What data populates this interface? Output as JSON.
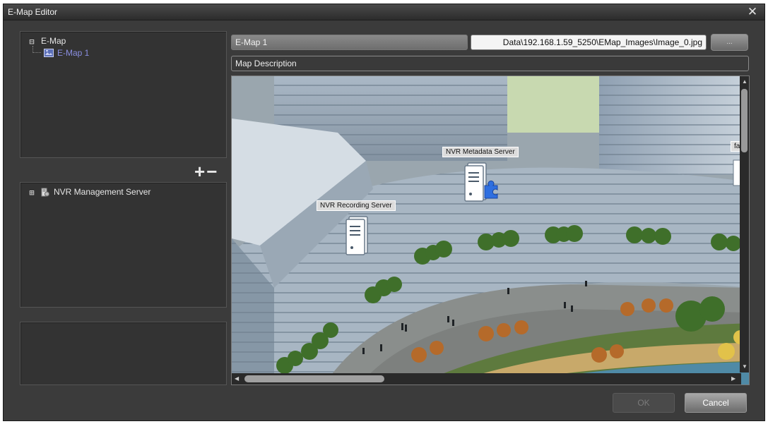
{
  "window": {
    "title": "E-Map Editor",
    "close_glyph": "✕"
  },
  "map_tree": {
    "root": {
      "expander": "⊟",
      "label": "E-Map"
    },
    "child": {
      "label": "E-Map 1",
      "icon": "map-icon",
      "selected": true
    }
  },
  "toolbar": {
    "add_glyph": "+",
    "remove_glyph": "−"
  },
  "server_tree": {
    "root": {
      "expander": "⊞",
      "label": "NVR Management Server",
      "icon": "server-group-icon"
    }
  },
  "map_fields": {
    "name_value": "E-Map 1",
    "image_path": "Data\\192.168.1.59_5250\\EMap_Images\\Image_0.jpg",
    "browse_label": "...",
    "description_placeholder": "Map Description"
  },
  "map_markers": [
    {
      "label": "NVR Metadata Server",
      "icon": "metadata-server-icon"
    },
    {
      "label": "NVR Recording Server",
      "icon": "recording-server-icon"
    },
    {
      "label": "fa",
      "icon": "server-icon"
    }
  ],
  "buttons": {
    "ok_label": "OK",
    "cancel_label": "Cancel"
  },
  "colors": {
    "dialog_bg": "#3b3b3b",
    "selected_item": "#8a8ee0",
    "accent_plugin": "#2f6fe0"
  }
}
